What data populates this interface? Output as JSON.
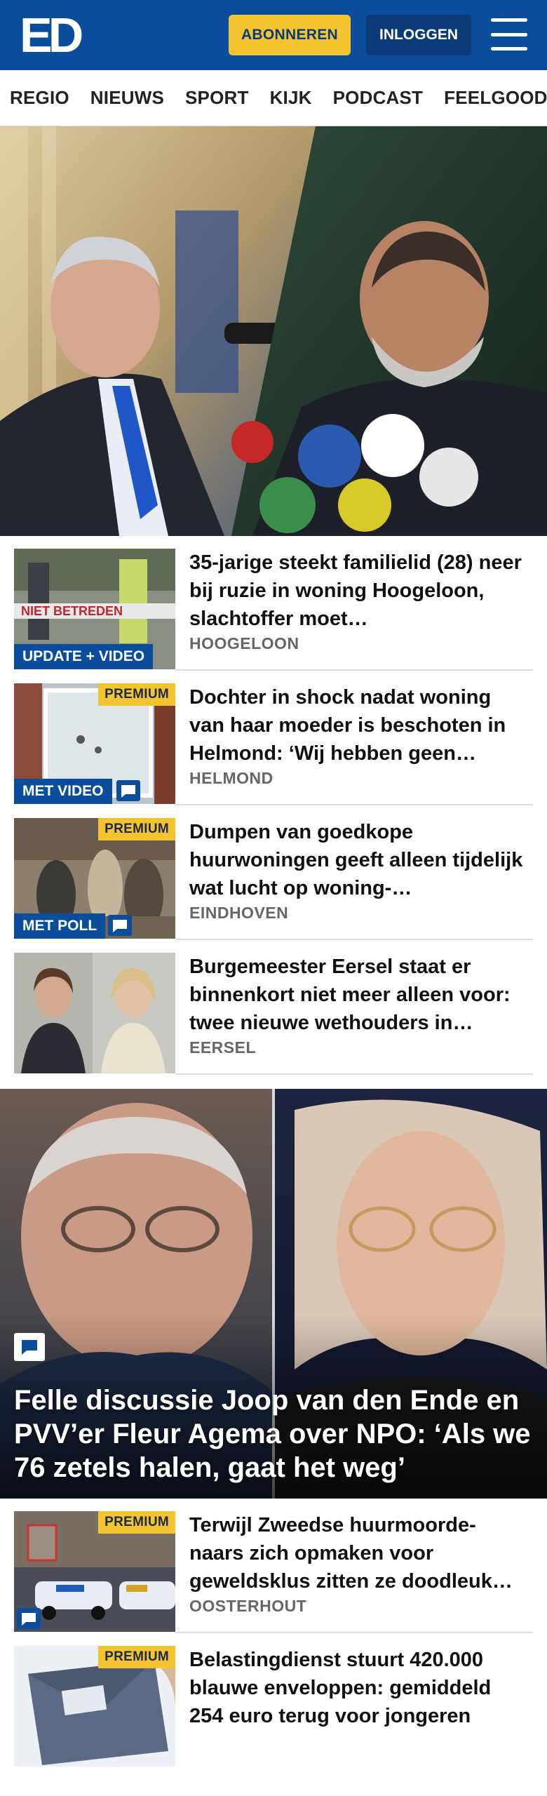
{
  "header": {
    "logo_text": "ED",
    "subscribe_label": "ABONNEREN",
    "login_label": "INLOGGEN",
    "menu_icon": "hamburger-icon",
    "brand_color": "#0a4e9b",
    "accent_color": "#f4c430"
  },
  "nav": {
    "items": [
      "REGIO",
      "NIEUWS",
      "SPORT",
      "KIJK",
      "PODCAST",
      "FEELGOOD"
    ]
  },
  "articles": [
    {
      "title": "35-jarige steekt familielid (28) neer bij ruzie in woning Hoogeloon, slachtoffer moet…",
      "location": "HOOGELOON",
      "badge": "UPDATE + VIDEO",
      "thumb_text": "NIET BETREDEN"
    },
    {
      "title": "Dochter in shock nadat woning van haar moeder is beschoten in Helmond: ‘Wij hebben geen…",
      "location": "HELMOND",
      "badge": "MET VIDEO",
      "premium": "PREMIUM"
    },
    {
      "title": "Dumpen van goedkope huurwoningen geeft alleen tijdelijk wat lucht op woning-…",
      "location": "EINDHOVEN",
      "badge": "MET POLL",
      "premium": "PREMIUM"
    },
    {
      "title": "Burgemeester Eersel staat er binnenkort niet meer alleen voor: twee nieuwe wethouders in…",
      "location": "EERSEL"
    }
  ],
  "feature": {
    "title": "Felle discussie Joop van den Ende en PVV’er Fleur Agema over NPO: ‘Als we 76 zetels halen, gaat het weg’"
  },
  "articles_bottom": [
    {
      "title": "Terwijl Zweedse huurmoorde-naars zich opmaken voor geweldsklus zitten ze doodleuk…",
      "location": "OOSTERHOUT",
      "premium": "PREMIUM"
    },
    {
      "title": "Belastingdienst stuurt 420.000 blauwe enveloppen: gemiddeld 254 euro terug voor jongeren",
      "location": "",
      "premium": "PREMIUM"
    }
  ]
}
